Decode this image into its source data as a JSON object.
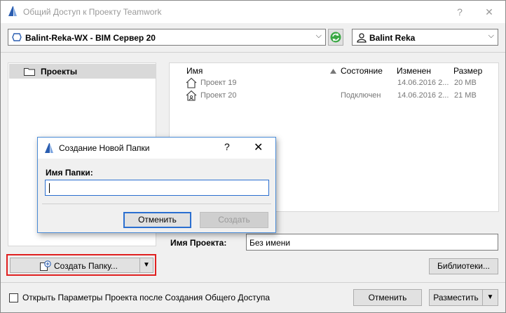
{
  "window": {
    "title": "Общий Доступ к Проекту Teamwork",
    "help": "?",
    "close": "✕"
  },
  "server_combo": {
    "label": "Balint-Reka-WX - BIM Сервер 20"
  },
  "user_combo": {
    "label": "Balint Reka"
  },
  "tree": {
    "root_label": "Проекты"
  },
  "list": {
    "headers": {
      "name": "Имя",
      "state": "Состояние",
      "modified": "Изменен",
      "size": "Размер"
    },
    "rows": [
      {
        "name": "Проект 19",
        "state": "",
        "modified": "14.06.2016 2...",
        "size": "20 MB"
      },
      {
        "name": "Проект 20",
        "state": "Подключен",
        "modified": "14.06.2016 2...",
        "size": "21 MB"
      }
    ]
  },
  "project_name": {
    "label": "Имя Проекта:",
    "value": "Без имени"
  },
  "buttons": {
    "create_folder": "Создать Папку...",
    "libraries": "Библиотеки...",
    "cancel": "Отменить",
    "share": "Разместить"
  },
  "checkbox": {
    "label": "Открыть Параметры Проекта после Создания Общего Доступа"
  },
  "dialog": {
    "title": "Создание Новой Папки",
    "help": "?",
    "close": "✕",
    "folder_label": "Имя Папки:",
    "folder_value": "",
    "cancel": "Отменить",
    "create": "Создать"
  },
  "icons": {
    "app": "archicad-icon",
    "server": "server-icon",
    "refresh": "refresh-icon",
    "user": "user-icon",
    "folder": "folder-icon",
    "project": "project-house-icon",
    "new_folder": "new-folder-icon"
  },
  "colors": {
    "highlight": "#e02020",
    "focus": "#2b6fd0",
    "refresh": "#2f9a36"
  }
}
